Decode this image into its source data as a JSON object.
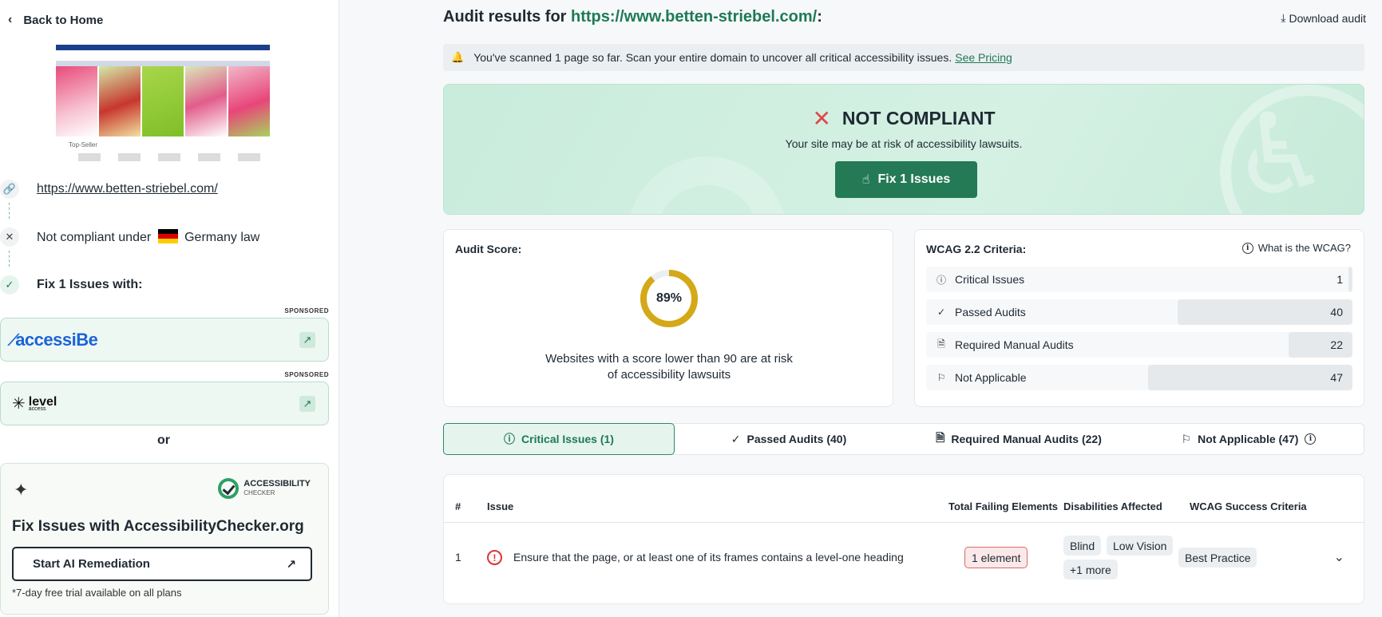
{
  "sidebar": {
    "back_label": "Back to Home",
    "thumbnail_caption": "Top-Seller",
    "site_url": "https://www.betten-striebel.com/",
    "compliance_prefix": "Not compliant under",
    "compliance_law": "Germany law",
    "fix_label": "Fix 1 Issues with:",
    "sponsored_label": "SPONSORED",
    "sponsor1_name": "accessiBe",
    "sponsor2_name": "level",
    "sponsor2_sub": "access",
    "or_label": "or",
    "ac_logo_title": "ACCESSIBILITY",
    "ac_logo_sub": "CHECKER",
    "ac_title": "Fix Issues with AccessibilityChecker.org",
    "ac_button": "Start AI Remediation",
    "ac_note": "*7-day free trial available on all plans"
  },
  "header": {
    "title_prefix": "Audit results for",
    "url": "https://www.betten-striebel.com/",
    "title_suffix": ":",
    "download_label": "Download audit"
  },
  "notice": {
    "text": "You've scanned 1 page so far. Scan your entire domain to uncover all critical accessibility issues.",
    "link": "See Pricing"
  },
  "status": {
    "heading": "NOT COMPLIANT",
    "subtext": "Your site may be at risk of accessibility lawsuits.",
    "button": "Fix 1 Issues"
  },
  "score": {
    "label": "Audit Score:",
    "value": 89,
    "display": "89%",
    "description_line1": "Websites with a score lower than 90 are at risk",
    "description_line2": "of accessibility lawsuits",
    "color": "#d4a817"
  },
  "wcag": {
    "label": "WCAG 2.2 Criteria:",
    "help_label": "What is the WCAG?",
    "rows": [
      {
        "label": "Critical Issues",
        "value": "1",
        "fraction": 0.01
      },
      {
        "label": "Passed Audits",
        "value": "40",
        "fraction": 0.41
      },
      {
        "label": "Required Manual Audits",
        "value": "22",
        "fraction": 0.15
      },
      {
        "label": "Not Applicable",
        "value": "47",
        "fraction": 0.48
      }
    ]
  },
  "tabs": [
    {
      "label": "Critical Issues (1)"
    },
    {
      "label": "Passed Audits (40)"
    },
    {
      "label": "Required Manual Audits (22)"
    },
    {
      "label": "Not Applicable (47)"
    }
  ],
  "issues_table": {
    "columns": [
      "#",
      "Issue",
      "Total Failing Elements",
      "Disabilities Affected",
      "WCAG Success Criteria"
    ],
    "rows": [
      {
        "num": "1",
        "issue": "Ensure that the page, or at least one of its frames contains a level-one heading",
        "failing": "1 element",
        "disabilities": [
          "Blind",
          "Low Vision"
        ],
        "more": "+1 more",
        "criteria": "Best Practice"
      }
    ]
  },
  "colors": {
    "brand_green": "#237a55",
    "error_red": "#e04848"
  }
}
